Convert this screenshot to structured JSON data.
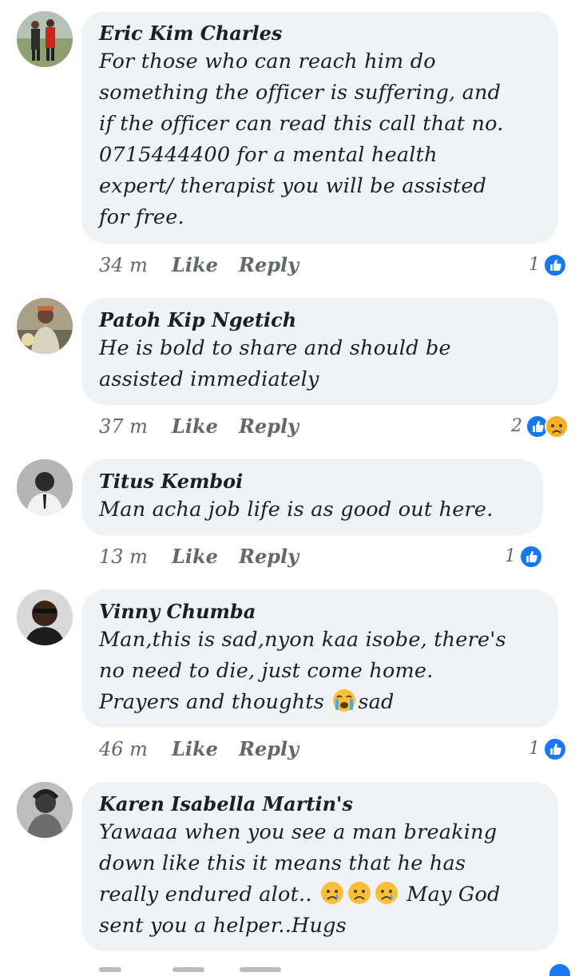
{
  "comments": [
    {
      "author": "Eric Kim Charles",
      "lines": [
        "For those who can reach him do",
        "something the officer is suffering, and",
        "if the officer can read this call that no.",
        "0715444400 for a mental health",
        "expert/ therapist you will be assisted",
        "for free."
      ],
      "time": "34 m",
      "like": "Like",
      "reply": "Reply",
      "reaction_count": "1",
      "reactions": [
        "like-icon"
      ]
    },
    {
      "author": "Patoh Kip Ngetich",
      "lines": [
        "He is bold to share and should be",
        "assisted immediately"
      ],
      "time": "37 m",
      "like": "Like",
      "reply": "Reply",
      "reaction_count": "2",
      "reactions": [
        "like-icon",
        "sad-icon"
      ]
    },
    {
      "author": "Titus Kemboi",
      "lines": [
        "Man acha job life is as good out here."
      ],
      "time": "13 m",
      "like": "Like",
      "reply": "Reply",
      "reaction_count": "1",
      "reactions": [
        "like-icon"
      ]
    },
    {
      "author": "Vinny Chumba",
      "lines": [
        "Man,this is sad,nyon kaa isobe, there's",
        "no need to die, just come home."
      ],
      "line3_a": "Prayers and thoughts ",
      "line3_b": "sad",
      "time": "46 m",
      "like": "Like",
      "reply": "Reply",
      "reaction_count": "1",
      "reactions": [
        "like-icon"
      ]
    },
    {
      "author": "Karen Isabella Martin's",
      "lines": [
        "Yawaaa when you see a man breaking",
        "down like this it means that he has"
      ],
      "line3_a": "really endured alot.. ",
      "line3_b": " May God",
      "line4": "sent you a helper..Hugs"
    }
  ],
  "colors": {
    "bubble": "#f0f2f5",
    "like_blue": "#1877f2",
    "meta": "#65676b"
  }
}
